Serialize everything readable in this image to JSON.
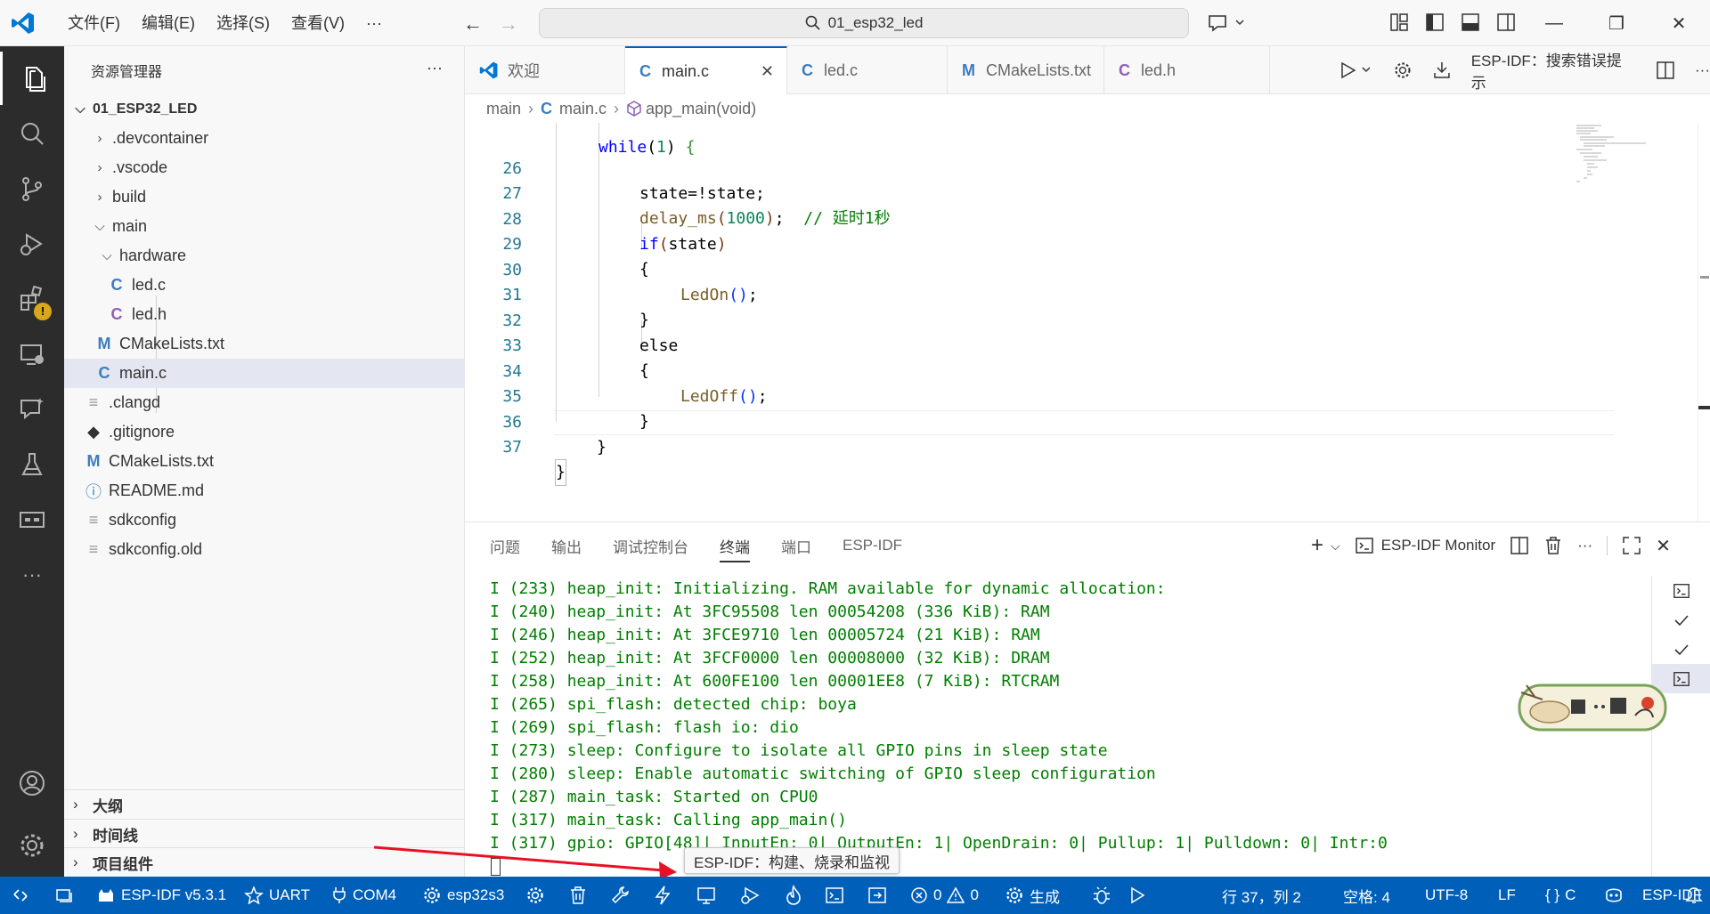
{
  "titlebar": {
    "menus": [
      "文件(F)",
      "编辑(E)",
      "选择(S)",
      "查看(V)",
      "···"
    ],
    "search_text": "01_esp32_led"
  },
  "sidebar": {
    "title": "资源管理器",
    "root": "01_ESP32_LED",
    "items": [
      {
        "label": ".devcontainer",
        "type": "folder-closed"
      },
      {
        "label": ".vscode",
        "type": "folder-closed"
      },
      {
        "label": "build",
        "type": "folder-closed"
      },
      {
        "label": "main",
        "type": "folder-open"
      },
      {
        "label": "hardware",
        "type": "folder-open"
      },
      {
        "label": "led.c",
        "type": "c"
      },
      {
        "label": "led.h",
        "type": "h"
      },
      {
        "label": "CMakeLists.txt",
        "type": "cmake"
      },
      {
        "label": "main.c",
        "type": "c"
      },
      {
        "label": ".clangd",
        "type": "lines"
      },
      {
        "label": ".gitignore",
        "type": "git"
      },
      {
        "label": "CMakeLists.txt",
        "type": "cmake"
      },
      {
        "label": "README.md",
        "type": "info"
      },
      {
        "label": "sdkconfig",
        "type": "lines"
      },
      {
        "label": "sdkconfig.old",
        "type": "lines"
      }
    ],
    "sections": [
      "大纲",
      "时间线",
      "项目组件"
    ]
  },
  "tabs": [
    {
      "label": "欢迎",
      "icon": "vscode-icon"
    },
    {
      "label": "main.c",
      "icon": "c",
      "active": true
    },
    {
      "label": "led.c",
      "icon": "c"
    },
    {
      "label": "CMakeLists.txt",
      "icon": "cmake"
    },
    {
      "label": "led.h",
      "icon": "h"
    }
  ],
  "editor_actions": {
    "esp_search": "ESP-IDF：搜索错误提示"
  },
  "breadcrumb": [
    "main",
    "main.c",
    "app_main(void)"
  ],
  "code": {
    "line_numbers": [
      "26",
      "27",
      "28",
      "29",
      "30",
      "31",
      "32",
      "33",
      "34",
      "35",
      "36",
      "37"
    ],
    "partial_top": "while(1) {"
  },
  "panel": {
    "tabs": [
      "问题",
      "输出",
      "调试控制台",
      "终端",
      "端口",
      "ESP-IDF"
    ],
    "active_tab": "终端",
    "monitor_label": "ESP-IDF Monitor",
    "terminal_lines": [
      "I (233) heap_init: Initializing. RAM available for dynamic allocation:",
      "I (240) heap_init: At 3FC95508 len 00054208 (336 KiB): RAM",
      "I (246) heap_init: At 3FCE9710 len 00005724 (21 KiB): RAM",
      "I (252) heap_init: At 3FCF0000 len 00008000 (32 KiB): DRAM",
      "I (258) heap_init: At 600FE100 len 00001EE8 (7 KiB): RTCRAM",
      "I (265) spi_flash: detected chip: boya",
      "I (269) spi_flash: flash io: dio",
      "I (273) sleep: Configure to isolate all GPIO pins in sleep state",
      "I (280) sleep: Enable automatic switching of GPIO sleep configuration",
      "I (287) main_task: Started on CPU0",
      "I (317) main_task: Calling app_main()",
      "I (317) gpio: GPIO[48]| InputEn: 0| OutputEn: 1| OpenDrain: 0| Pullup: 1| Pulldown: 0| Intr:0"
    ]
  },
  "tooltip": "ESP-IDF：构建、烧录和监视",
  "statusbar": {
    "idf_version": "ESP-IDF v5.3.1",
    "flash_method": "UART",
    "port": "COM4",
    "target": "esp32s3",
    "errors": "0",
    "warnings": "0",
    "build": "生成",
    "cursor_position": "行 37，列 2",
    "indent": "空格: 4",
    "encoding": "UTF-8",
    "eol": "LF",
    "language": "C",
    "esp_idf": "ESP-IDF"
  },
  "colors": {
    "accent": "#005fb8",
    "terminal_text": "#007f00",
    "highlight_circle": "#e81123"
  }
}
